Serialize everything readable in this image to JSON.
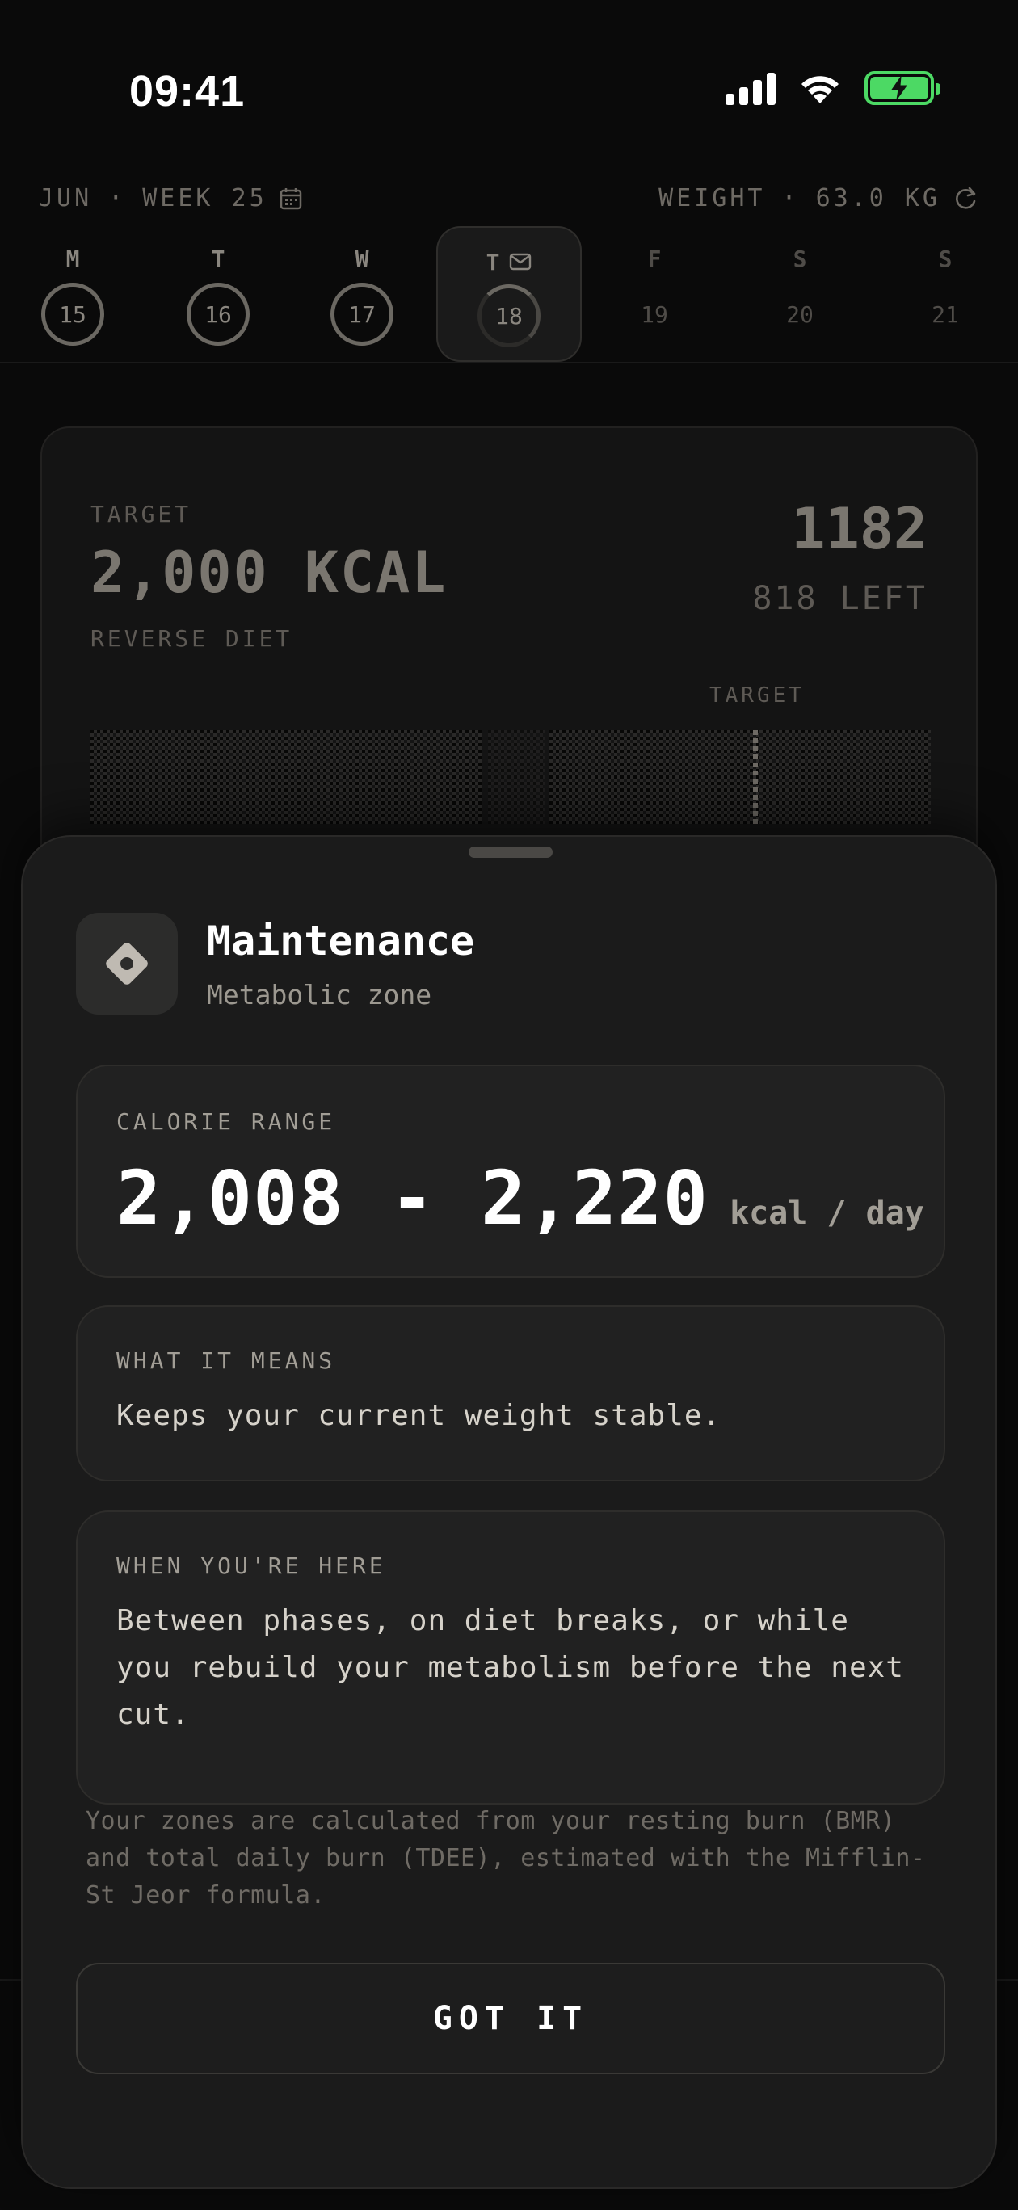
{
  "status_bar": {
    "time": "09:41",
    "battery_color": "#4cd964"
  },
  "week_header": {
    "month": "JUN",
    "separator": "·",
    "week": "WEEK 25",
    "weight_label": "WEIGHT",
    "weight_value": "63.0 KG",
    "calendar_icon": "calendar-icon",
    "sync_icon": "refresh-icon"
  },
  "days": [
    {
      "letter": "M",
      "date": "15",
      "state": "past"
    },
    {
      "letter": "T",
      "date": "16",
      "state": "past"
    },
    {
      "letter": "W",
      "date": "17",
      "state": "past"
    },
    {
      "letter": "T",
      "date": "18",
      "state": "today"
    },
    {
      "letter": "F",
      "date": "19",
      "state": "future"
    },
    {
      "letter": "S",
      "date": "20",
      "state": "future"
    },
    {
      "letter": "S",
      "date": "21",
      "state": "future"
    }
  ],
  "summary_card": {
    "target_label": "TARGET",
    "target_value": "2,000 KCAL",
    "mode": "REVERSE DIET",
    "eaten": "1182",
    "left": "818 LEFT",
    "bar_label": "TARGET"
  },
  "sheet": {
    "icon": "diamond-icon",
    "title": "Maintenance",
    "subtitle": "Metabolic zone",
    "range": {
      "label": "CALORIE RANGE",
      "value": "2,008 - 2,220",
      "unit": "kcal / day"
    },
    "means": {
      "label": "WHAT IT MEANS",
      "text": "Keeps your current weight stable."
    },
    "when": {
      "label": "WHEN YOU'RE HERE",
      "text": "Between phases, on diet breaks, or while you rebuild your metabolism before the next cut."
    },
    "footnote": "Your zones are calculated from your resting burn (BMR) and total daily burn (TDEE), estimated with the Mifflin-St Jeor formula.",
    "button_label": "GOT IT"
  }
}
